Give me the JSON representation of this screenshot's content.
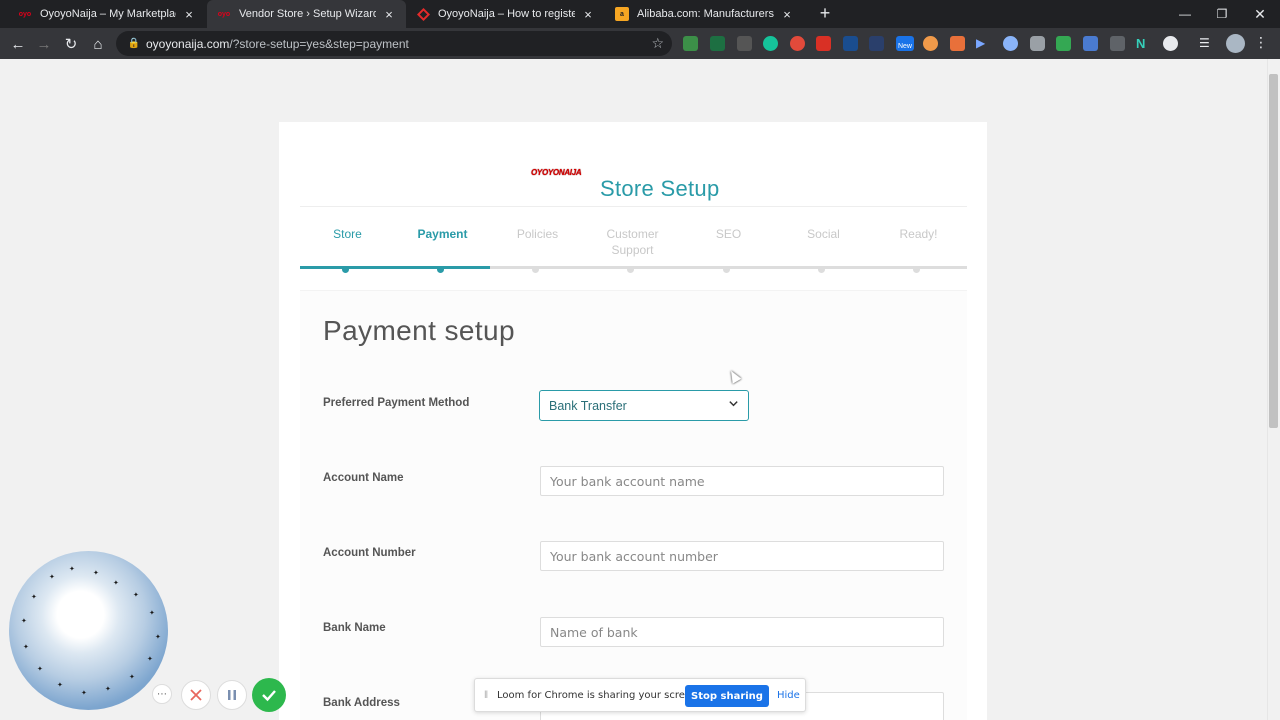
{
  "browser": {
    "tabs": [
      {
        "title": "OyoyoNaija – My Marketplace",
        "active": false,
        "favicon": "oyoyo-favicon"
      },
      {
        "title": "Vendor Store › Setup Wizard",
        "active": true,
        "favicon": "oyoyo-favicon"
      },
      {
        "title": "OyoyoNaija – How to register as",
        "active": false,
        "favicon": "oyoyo-red-favicon"
      },
      {
        "title": "Alibaba.com: Manufacturers, Sup",
        "active": false,
        "favicon": "alibaba-favicon"
      }
    ],
    "new_tab_label": "+",
    "url_host": "oyoyonaija.com",
    "url_path": "/?store-setup=yes&step=payment",
    "extension_new_badge": "New"
  },
  "wizard": {
    "logo_text": "OYOYONAIJA",
    "title": "Store Setup",
    "steps": [
      {
        "label": "Store",
        "state": "done"
      },
      {
        "label": "Payment",
        "state": "active"
      },
      {
        "label": "Policies",
        "state": "todo"
      },
      {
        "label": "Customer Support",
        "state": "todo"
      },
      {
        "label": "SEO",
        "state": "todo"
      },
      {
        "label": "Social",
        "state": "todo"
      },
      {
        "label": "Ready!",
        "state": "todo"
      }
    ],
    "progress_fraction": 0.285
  },
  "payment": {
    "heading": "Payment setup",
    "method_label": "Preferred Payment Method",
    "method_value": "Bank Transfer",
    "account_name_label": "Account Name",
    "account_name_placeholder": "Your bank account name",
    "account_number_label": "Account Number",
    "account_number_placeholder": "Your bank account number",
    "bank_name_label": "Bank Name",
    "bank_name_placeholder": "Name of bank",
    "bank_address_label": "Bank Address"
  },
  "loom": {
    "sharing_message": "Loom for Chrome is sharing your screen.",
    "stop_label": "Stop sharing",
    "hide_label": "Hide"
  },
  "colors": {
    "accent": "#2a9ba8",
    "brand_red": "#d60000",
    "loom_blue": "#1a73e8",
    "loom_green": "#2db84d",
    "loom_red": "#e8675e"
  }
}
